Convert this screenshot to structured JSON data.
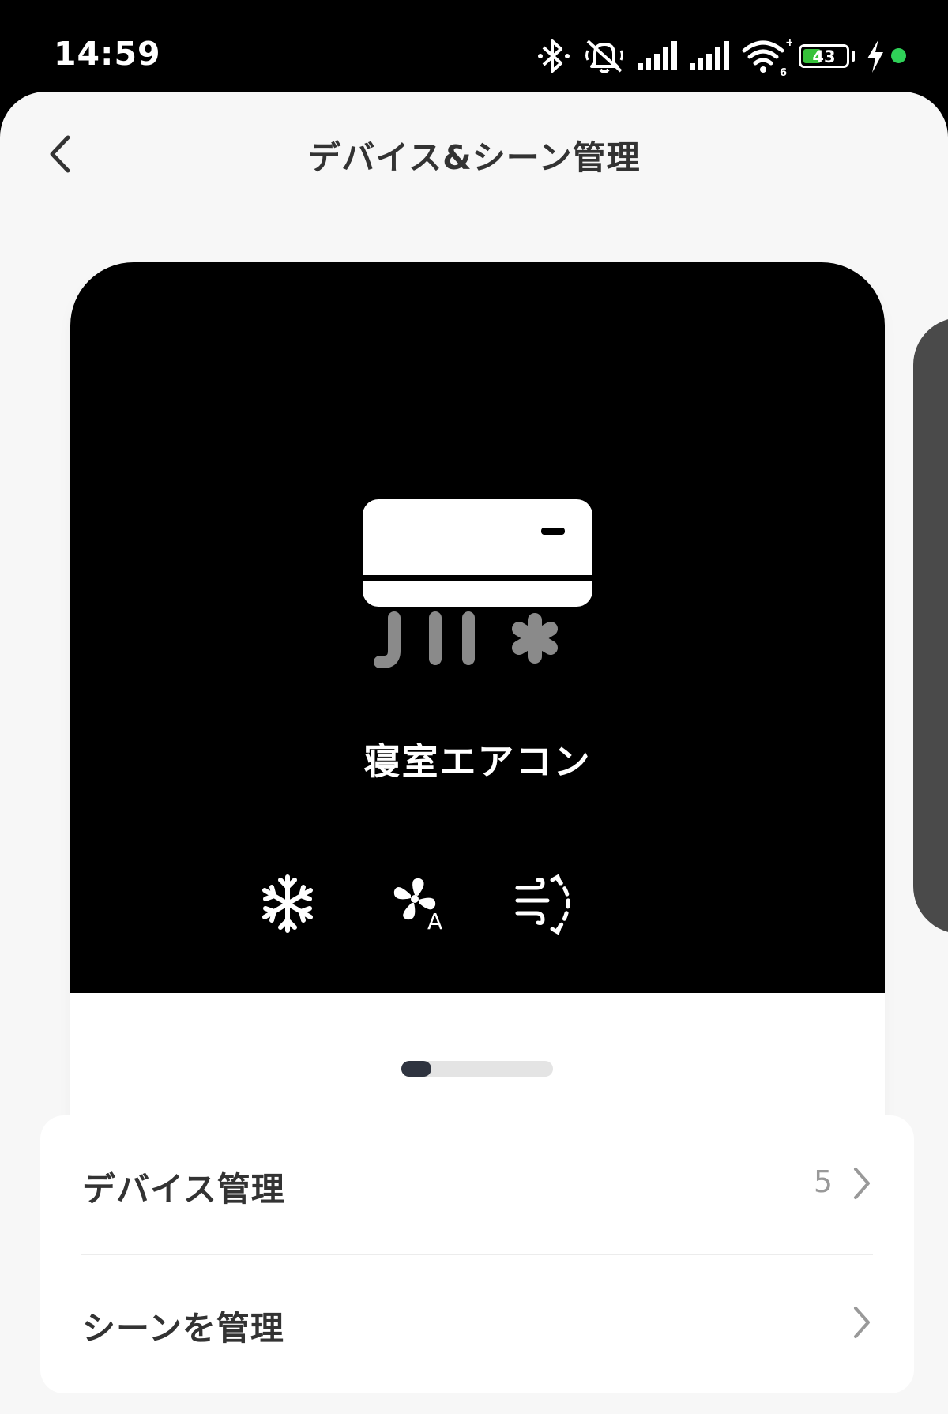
{
  "status_bar": {
    "time": "14:59",
    "battery_level": "43",
    "battery_fraction": 0.43,
    "icons": [
      "bluetooth-icon",
      "muted-bell-icon",
      "signal-icon",
      "signal-icon",
      "wifi-icon",
      "battery-icon",
      "charging-icon",
      "status-dot-icon"
    ],
    "colors": {
      "battery": "#36c23a",
      "dot": "#2fd158"
    }
  },
  "header": {
    "title": "デバイス&シーン管理",
    "back_icon": "chevron-left-icon"
  },
  "device_card": {
    "name": "寝室エアコン",
    "illustration": "air-conditioner-icon",
    "modes": [
      "snowflake-icon",
      "fan-auto-icon",
      "swing-airflow-icon"
    ],
    "mode_fan_label": "A",
    "pager": {
      "pages": 5,
      "current": 1
    }
  },
  "menu": {
    "items": [
      {
        "label": "デバイス管理",
        "count": "5",
        "icon": "chevron-right-icon"
      },
      {
        "label": "シーンを管理",
        "count": "",
        "icon": "chevron-right-icon"
      }
    ]
  }
}
